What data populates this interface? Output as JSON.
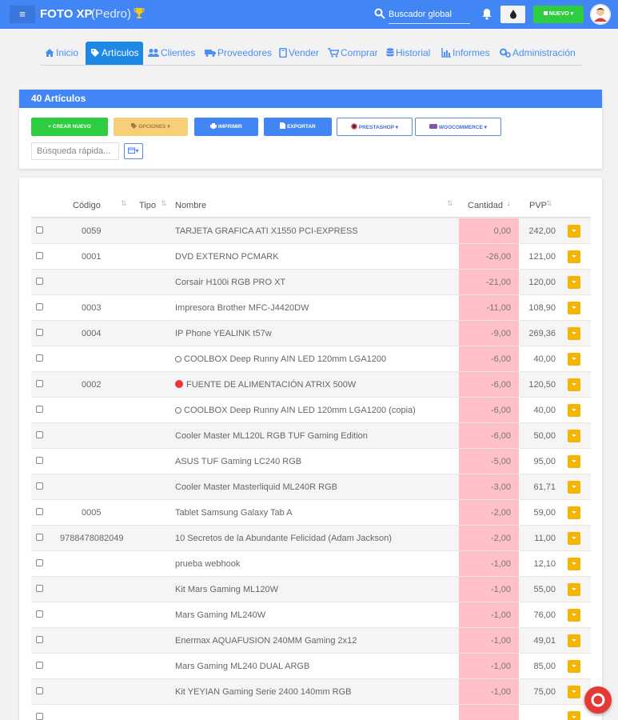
{
  "header": {
    "app_title": "FOTO XP",
    "user": "(Pedro)",
    "search_placeholder": "Buscador global",
    "new_button": "NUEVO"
  },
  "nav": {
    "tabs": [
      {
        "label": "Inicio",
        "icon": "home-icon"
      },
      {
        "label": "Artículos",
        "icon": "tag-icon",
        "active": true
      },
      {
        "label": "Clientes",
        "icon": "users-icon"
      },
      {
        "label": "Proveedores",
        "icon": "truck-icon"
      },
      {
        "label": "Vender",
        "icon": "book-icon"
      },
      {
        "label": "Comprar",
        "icon": "cart-icon"
      },
      {
        "label": "Historial",
        "icon": "database-icon"
      },
      {
        "label": "Informes",
        "icon": "chart-icon"
      },
      {
        "label": "Administración",
        "icon": "gears-icon"
      }
    ]
  },
  "articles": {
    "title": "40 Artículos",
    "buttons": {
      "create": "CREAR NUEVO",
      "options": "OPCIONES",
      "print": "IMPRIMIR",
      "export": "EXPORTAR",
      "prestashop": "PRESTASHOP",
      "woocommerce": "WOOCOMMERCE"
    },
    "quick_search_placeholder": "Búsqueda rápida..."
  },
  "table": {
    "columns": {
      "code": "Código",
      "type": "Tipo",
      "name": "Nombre",
      "quantity": "Cantidad",
      "price": "PVP"
    },
    "rows": [
      {
        "code": "0059",
        "name": "TARJETA GRAFICA ATI X1550 PCI-EXPRESS",
        "qty": "0,00",
        "pvp": "242,00"
      },
      {
        "code": "0001",
        "name": "DVD EXTERNO PCMARK",
        "qty": "-26,00",
        "pvp": "121,00"
      },
      {
        "code": "",
        "name": "Corsair H100i RGB PRO XT",
        "qty": "-21,00",
        "pvp": "120,00"
      },
      {
        "code": "0003",
        "name": "Impresora Brother MFC-J4420DW",
        "qty": "-11,00",
        "pvp": "108,90"
      },
      {
        "code": "0004",
        "name": "IP Phone YEALINK t57w",
        "qty": "-9,00",
        "pvp": "269,36"
      },
      {
        "code": "",
        "name": "COOLBOX Deep Runny AIN LED 120mm LGA1200",
        "qty": "-6,00",
        "pvp": "40,00",
        "prefix": "light-icon"
      },
      {
        "code": "0002",
        "name": "FUENTE DE ALIMENTACIÓN ATRIX 500W",
        "qty": "-6,00",
        "pvp": "120,50",
        "prefix": "no-entry-icon"
      },
      {
        "code": "",
        "name": "COOLBOX Deep Runny AIN LED 120mm LGA1200 (copia)",
        "qty": "-6,00",
        "pvp": "40,00",
        "prefix": "light-icon"
      },
      {
        "code": "",
        "name": "Cooler Master ML120L RGB TUF Gaming Edition",
        "qty": "-6,00",
        "pvp": "50,00"
      },
      {
        "code": "",
        "name": "ASUS TUF Gaming LC240 RGB",
        "qty": "-5,00",
        "pvp": "95,00"
      },
      {
        "code": "",
        "name": "Cooler Master Masterliquid ML240R RGB",
        "qty": "-3,00",
        "pvp": "61,71"
      },
      {
        "code": "0005",
        "name": "Tablet Samsung Galaxy Tab A",
        "qty": "-2,00",
        "pvp": "59,00"
      },
      {
        "code": "9788478082049",
        "name": "10 Secretos de la Abundante Felicidad (Adam Jackson)",
        "qty": "-2,00",
        "pvp": "11,00"
      },
      {
        "code": "",
        "name": "prueba webhook",
        "qty": "-1,00",
        "pvp": "12,10"
      },
      {
        "code": "",
        "name": "Kit Mars Gaming ML120W",
        "qty": "-1,00",
        "pvp": "55,00"
      },
      {
        "code": "",
        "name": "Mars Gaming ML240W",
        "qty": "-1,00",
        "pvp": "76,00"
      },
      {
        "code": "",
        "name": "Enermax AQUAFUSION 240MM Gaming 2x12",
        "qty": "-1,00",
        "pvp": "49,01"
      },
      {
        "code": "",
        "name": "Mars Gaming ML240 DUAL ARGB",
        "qty": "-1,00",
        "pvp": "85,00"
      },
      {
        "code": "",
        "name": "Kit YEYIAN Gaming Serie 2400 140mm RGB",
        "qty": "-1,00",
        "pvp": "75,00"
      }
    ]
  },
  "colors": {
    "primary": "#4285f4",
    "success": "#2ecc40",
    "warning": "#f5b400",
    "negative_qty_bg": "#ffc0c8"
  }
}
